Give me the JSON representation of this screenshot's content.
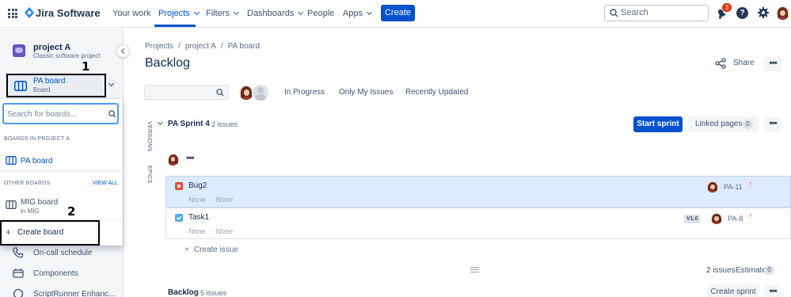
{
  "topnav": {
    "logo_text": "Jira Software",
    "items": [
      {
        "label": "Your work"
      },
      {
        "label": "Projects"
      },
      {
        "label": "Filters"
      },
      {
        "label": "Dashboards"
      },
      {
        "label": "People"
      },
      {
        "label": "Apps"
      }
    ],
    "active_item": "Projects",
    "create_label": "Create",
    "search_placeholder": "Search",
    "notification_count": "3",
    "help_glyph": "?",
    "accent_color": "#0052cc"
  },
  "sidebar": {
    "project_name": "project A",
    "project_type": "Classic software project",
    "current_board": {
      "name": "PA board",
      "sub": "Board"
    },
    "annotation_1": "1",
    "annotation_2": "2",
    "board_dropdown": {
      "search_placeholder": "Search for boards...",
      "section_project": "BOARDS IN PROJECT A",
      "project_boards": [
        {
          "name": "PA board"
        }
      ],
      "section_other": "OTHER BOARDS",
      "view_all": "VIEW ALL",
      "other_boards": [
        {
          "name": "MIG board",
          "sub": "in MIG"
        }
      ],
      "create_board": "Create board"
    },
    "links": [
      {
        "label": "On-call schedule",
        "icon": "phone-icon"
      },
      {
        "label": "Components",
        "icon": "components-icon"
      },
      {
        "label": "ScriptRunner Enhanc...",
        "icon": "scriptrunner-icon"
      }
    ]
  },
  "main": {
    "breadcrumb": [
      "Projects",
      "project A",
      "PA board"
    ],
    "breadcrumb_sep": "/",
    "title": "Backlog",
    "share_label": "Share",
    "more_glyph": "•••",
    "quick_filters": [
      "In Progress",
      "Only My Issues",
      "Recently Updated"
    ],
    "side_tabs": [
      "VERSIONS",
      "EPICS"
    ],
    "sprint": {
      "name": "PA Sprint 4",
      "count": "2 issues",
      "start_label": "Start sprint",
      "linked_pages_label": "Linked pages",
      "linked_pages_count": "0",
      "issues": [
        {
          "summary": "Bug2",
          "type": "bug",
          "epic": "None",
          "version": "None",
          "key": "PA-11",
          "version_badge": "",
          "priority": "↑",
          "selected": true
        },
        {
          "summary": "Task1",
          "type": "task",
          "epic": "None",
          "version": "None",
          "key": "PA-8",
          "version_badge": "V1.0",
          "priority": "↑",
          "selected": false
        }
      ],
      "create_issue": "Create issue",
      "create_issue_plus": "+",
      "issues_summary": "2 issues",
      "estimate_label": "Estimate",
      "estimate_value": "0"
    },
    "backlog": {
      "name": "Backlog",
      "count": "5 issues",
      "create_sprint": "Create sprint"
    },
    "colors": {
      "bug": "#e5493a",
      "task": "#4bade8",
      "priority": "#ff7452",
      "selected_row": "#deebff"
    }
  }
}
